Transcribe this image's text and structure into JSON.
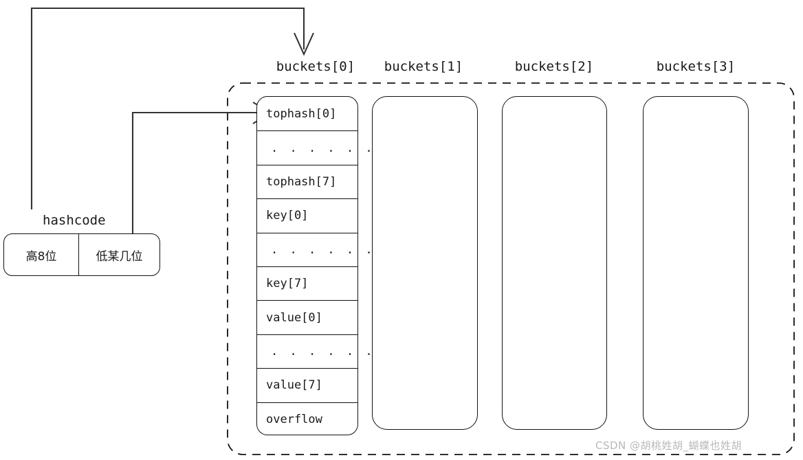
{
  "diagram": {
    "title_watermark": "CSDN @胡桃姓胡_蝴蝶也姓胡",
    "hashcode": {
      "label": "hashcode",
      "high_bits": "高8位",
      "low_bits": "低某几位"
    },
    "bucket_labels": [
      "buckets[0]",
      "buckets[1]",
      "buckets[2]",
      "buckets[3]"
    ],
    "bucket0_cells": [
      "tophash[0]",
      ". . . . . . .",
      "tophash[7]",
      "key[0]",
      ". . . . . . .",
      "key[7]",
      "value[0]",
      ". . . . . . .",
      "value[7]",
      "overflow"
    ],
    "colors": {
      "stroke": "#111111",
      "text": "#1a1a1a",
      "background": "#ffffff",
      "watermark": "#b8b8b8"
    }
  }
}
